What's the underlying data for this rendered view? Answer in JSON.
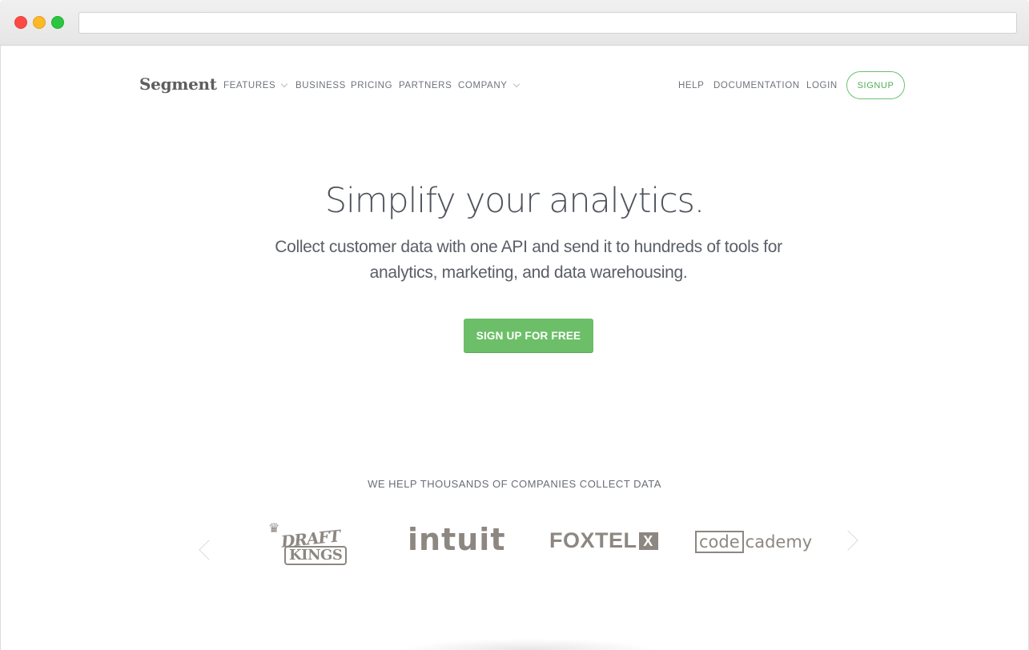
{
  "browser": {
    "address": ""
  },
  "nav": {
    "logo": "Segment",
    "left_items": [
      {
        "label": "FEATURES",
        "has_dropdown": true
      },
      {
        "label": "BUSINESS",
        "has_dropdown": false
      },
      {
        "label": "PRICING",
        "has_dropdown": false
      },
      {
        "label": "PARTNERS",
        "has_dropdown": false
      },
      {
        "label": "COMPANY",
        "has_dropdown": true
      }
    ],
    "right_items": [
      {
        "label": "HELP"
      },
      {
        "label": "DOCUMENTATION"
      },
      {
        "label": "LOGIN"
      }
    ],
    "signup_label": "SIGNUP"
  },
  "hero": {
    "title": "Simplify your analytics.",
    "subtitle_line1": "Collect customer data with one API and send it to hundreds of tools for",
    "subtitle_line2": "analytics, marketing, and data warehousing.",
    "cta_label": "SIGN UP FOR FREE"
  },
  "customers": {
    "heading": "WE HELP THOUSANDS OF COMPANIES COLLECT DATA",
    "logos": [
      {
        "name": "DraftKings",
        "line1": "DRAFT",
        "line2": "KINGS"
      },
      {
        "name": "Intuit",
        "text": "intuit"
      },
      {
        "name": "Foxtel",
        "text": "FOXTEL",
        "mark": "X"
      },
      {
        "name": "Codecademy",
        "boxed": "code",
        "rest": "cademy"
      }
    ],
    "prev_icon": "chevron-left-icon",
    "next_icon": "chevron-right-icon"
  },
  "colors": {
    "accent_green": "#6cbf68",
    "text_dark": "#4f535b",
    "logo_gray": "#8d8781"
  }
}
